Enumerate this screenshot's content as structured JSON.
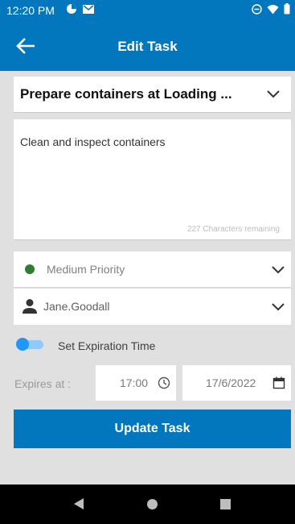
{
  "status_bar": {
    "time": "12:20 PM",
    "left_icons": [
      "data-saver-icon",
      "mail-icon"
    ],
    "right_icons": [
      "do-not-disturb-icon",
      "wifi-icon",
      "battery-icon"
    ]
  },
  "header": {
    "title": "Edit Task",
    "back_icon": "arrow-back-icon"
  },
  "task": {
    "name": "Prepare containers at Loading ...",
    "description": "Clean and inspect containers",
    "characters_remaining": "227 Characters remaining"
  },
  "priority": {
    "label": "Medium Priority",
    "color": "#2e7d32"
  },
  "assignee": {
    "name": "Jane.Goodall"
  },
  "expiration": {
    "toggle_label": "Set Expiration Time",
    "toggle_on": true,
    "expires_label": "Expires at :",
    "time": "17:00",
    "date": "17/6/2022"
  },
  "actions": {
    "update_label": "Update Task"
  },
  "colors": {
    "primary": "#0277bd",
    "toggle_accent": "#2196f3",
    "background": "#e0e0e0"
  }
}
